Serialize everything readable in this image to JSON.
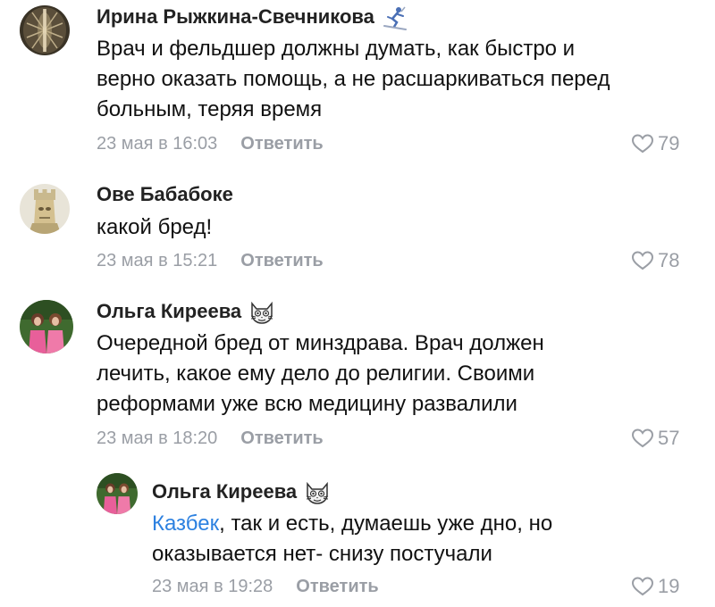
{
  "comments": [
    {
      "author": "Ирина Рыжкина-Свечникова",
      "author_emoji": "skier-icon",
      "text": "Врач и фельдшер должны думать, как быстро и\nверно оказать помощь, а не расшаркиваться перед\nбольным, теряя время",
      "date": "23 мая в 16:03",
      "reply_label": "Ответить",
      "likes": "79"
    },
    {
      "author": "Ове Бабабоке",
      "text": "какой бред!",
      "date": "23 мая в 15:21",
      "reply_label": "Ответить",
      "likes": "78"
    },
    {
      "author": "Ольга Киреева",
      "author_emoji": "cat-face-icon",
      "text": "Очередной бред от минздрава. Врач должен\nлечить, какое ему дело до религии. Своими\nреформами уже всю медицину развалили",
      "date": "23 мая в 18:20",
      "reply_label": "Ответить",
      "likes": "57"
    },
    {
      "author": "Ольга Киреева",
      "author_emoji": "cat-face-icon",
      "mention": "Казбек",
      "text": ", так и есть, думаешь уже дно, но\nоказывается нет- снизу постучали",
      "date": "23 мая в 19:28",
      "reply_label": "Ответить",
      "likes": "19"
    }
  ],
  "colors": {
    "meta_gray": "#9a9ea5",
    "mention_blue": "#2d81e0"
  }
}
